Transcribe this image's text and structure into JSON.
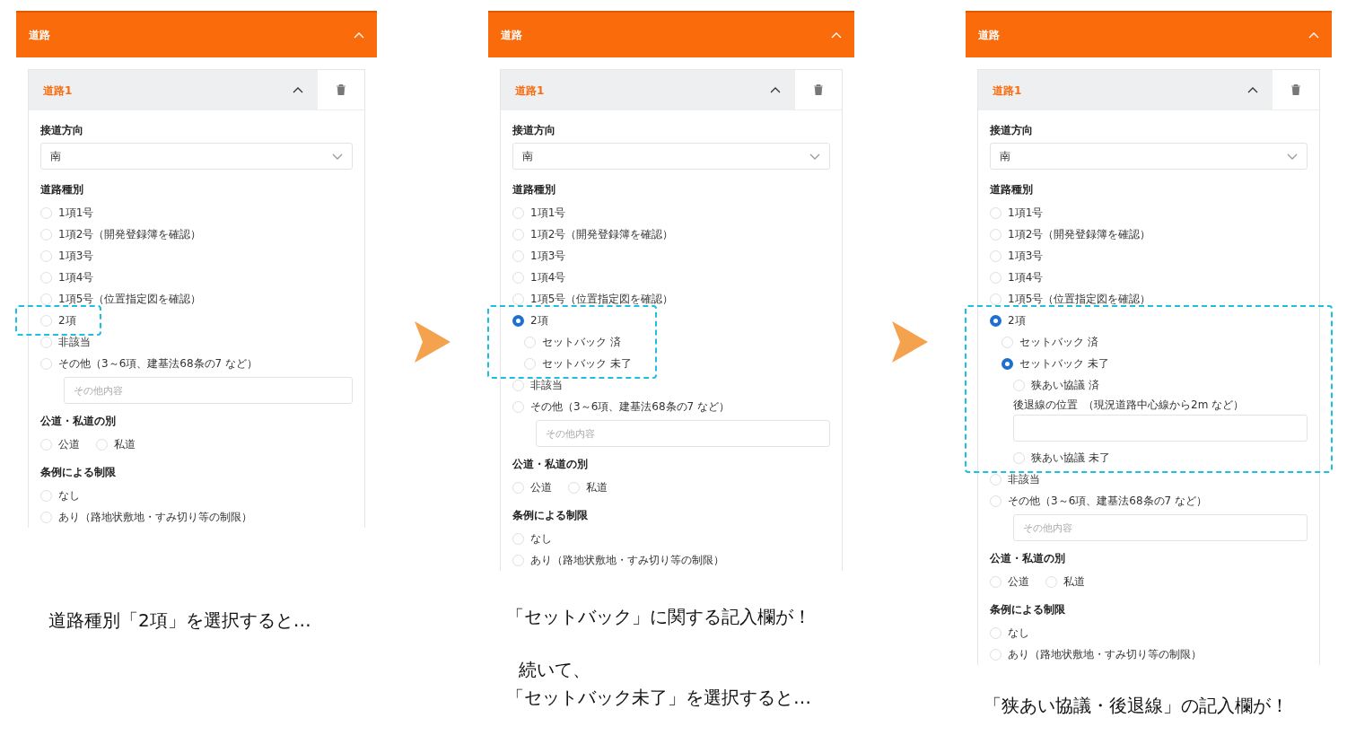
{
  "panels": [
    {
      "section": {
        "title": "道路",
        "expanded": true
      },
      "item": {
        "title": "道路1",
        "expanded": true
      },
      "direction": {
        "label": "接道方向",
        "value": "南"
      },
      "road_type": {
        "label": "道路種別",
        "options": [
          {
            "kind": "radio",
            "label": "1項1号",
            "selected": false,
            "highlighted": false
          },
          {
            "kind": "radio",
            "label": "1項2号（開発登録簿を確認）",
            "selected": false,
            "highlighted": false
          },
          {
            "kind": "radio",
            "label": "1項3号",
            "selected": false,
            "highlighted": false
          },
          {
            "kind": "radio",
            "label": "1項4号",
            "selected": false,
            "highlighted": false
          },
          {
            "kind": "radio",
            "label": "1項5号（位置指定図を確認）",
            "selected": false,
            "highlighted": false
          },
          {
            "kind": "radio",
            "label": "2項",
            "selected": false,
            "highlighted": true
          },
          {
            "kind": "radio",
            "label": "非該当",
            "selected": false,
            "highlighted": false
          },
          {
            "kind": "radio",
            "label": "その他（3～6項、建基法68条の7 など）",
            "selected": false,
            "highlighted": false
          },
          {
            "kind": "input",
            "placeholder": "その他内容",
            "highlighted": false
          }
        ]
      },
      "ownership": {
        "label": "公道・私道の別",
        "options": [
          {
            "label": "公道",
            "selected": false
          },
          {
            "label": "私道",
            "selected": false
          }
        ]
      },
      "ordinance": {
        "label": "条例による制限",
        "options": [
          {
            "label": "なし",
            "selected": false
          },
          {
            "label": "あり（路地状敷地・すみ切り等の制限）",
            "selected": false
          }
        ]
      },
      "captions": [
        "道路種別「2項」を選択すると…"
      ]
    },
    {
      "section": {
        "title": "道路",
        "expanded": true
      },
      "item": {
        "title": "道路1",
        "expanded": true
      },
      "direction": {
        "label": "接道方向",
        "value": "南"
      },
      "road_type": {
        "label": "道路種別",
        "options": [
          {
            "kind": "radio",
            "label": "1項1号",
            "selected": false,
            "highlighted": false
          },
          {
            "kind": "radio",
            "label": "1項2号（開発登録簿を確認）",
            "selected": false,
            "highlighted": false
          },
          {
            "kind": "radio",
            "label": "1項3号",
            "selected": false,
            "highlighted": false
          },
          {
            "kind": "radio",
            "label": "1項4号",
            "selected": false,
            "highlighted": false
          },
          {
            "kind": "radio",
            "label": "1項5号（位置指定図を確認）",
            "selected": false,
            "highlighted": false
          },
          {
            "kind": "radio",
            "label": "2項",
            "selected": true,
            "highlighted": true,
            "children": [
              {
                "kind": "radio",
                "label": "セットバック 済",
                "selected": false
              },
              {
                "kind": "radio",
                "label": "セットバック 未了",
                "selected": false
              }
            ]
          },
          {
            "kind": "radio",
            "label": "非該当",
            "selected": false,
            "highlighted": false
          },
          {
            "kind": "radio",
            "label": "その他（3～6項、建基法68条の7 など）",
            "selected": false,
            "highlighted": false
          },
          {
            "kind": "input",
            "placeholder": "その他内容",
            "highlighted": false
          }
        ]
      },
      "ownership": {
        "label": "公道・私道の別",
        "options": [
          {
            "label": "公道",
            "selected": false
          },
          {
            "label": "私道",
            "selected": false
          }
        ]
      },
      "ordinance": {
        "label": "条例による制限",
        "options": [
          {
            "label": "なし",
            "selected": false
          },
          {
            "label": "あり（路地状敷地・すみ切り等の制限）",
            "selected": false
          }
        ]
      },
      "captions": [
        "「セットバック」に関する記入欄が！",
        "続いて、",
        "「セットバック未了」を選択すると…"
      ]
    },
    {
      "section": {
        "title": "道路",
        "expanded": true
      },
      "item": {
        "title": "道路1",
        "expanded": true
      },
      "direction": {
        "label": "接道方向",
        "value": "南"
      },
      "road_type": {
        "label": "道路種別",
        "options": [
          {
            "kind": "radio",
            "label": "1項1号",
            "selected": false,
            "highlighted": false
          },
          {
            "kind": "radio",
            "label": "1項2号（開発登録簿を確認）",
            "selected": false,
            "highlighted": false
          },
          {
            "kind": "radio",
            "label": "1項3号",
            "selected": false,
            "highlighted": false
          },
          {
            "kind": "radio",
            "label": "1項4号",
            "selected": false,
            "highlighted": false
          },
          {
            "kind": "radio",
            "label": "1項5号（位置指定図を確認）",
            "selected": false,
            "highlighted": false
          },
          {
            "kind": "radio",
            "label": "2項",
            "selected": true,
            "highlighted": true,
            "children": [
              {
                "kind": "radio",
                "label": "セットバック 済",
                "selected": false
              },
              {
                "kind": "radio",
                "label": "セットバック 未了",
                "selected": true,
                "children": [
                  {
                    "kind": "radio",
                    "label": "狭あい協議 済",
                    "selected": false
                  },
                  {
                    "kind": "input",
                    "label": "後退線の位置",
                    "note": "（現況道路中心線から2m など）"
                  },
                  {
                    "kind": "radio",
                    "label": "狭あい協議 未了",
                    "selected": false
                  }
                ]
              }
            ]
          },
          {
            "kind": "radio",
            "label": "非該当",
            "selected": false,
            "highlighted": false
          },
          {
            "kind": "radio",
            "label": "その他（3～6項、建基法68条の7 など）",
            "selected": false,
            "highlighted": false
          },
          {
            "kind": "input",
            "placeholder": "その他内容",
            "highlighted": false
          }
        ]
      },
      "ownership": {
        "label": "公道・私道の別",
        "options": [
          {
            "label": "公道",
            "selected": false
          },
          {
            "label": "私道",
            "selected": false
          }
        ]
      },
      "ordinance": {
        "label": "条例による制限",
        "options": [
          {
            "label": "なし",
            "selected": false
          },
          {
            "label": "あり（路地状敷地・すみ切り等の制限）",
            "selected": false
          }
        ]
      },
      "captions": [
        "「狭あい協議・後退線」の記入欄が！"
      ]
    }
  ]
}
